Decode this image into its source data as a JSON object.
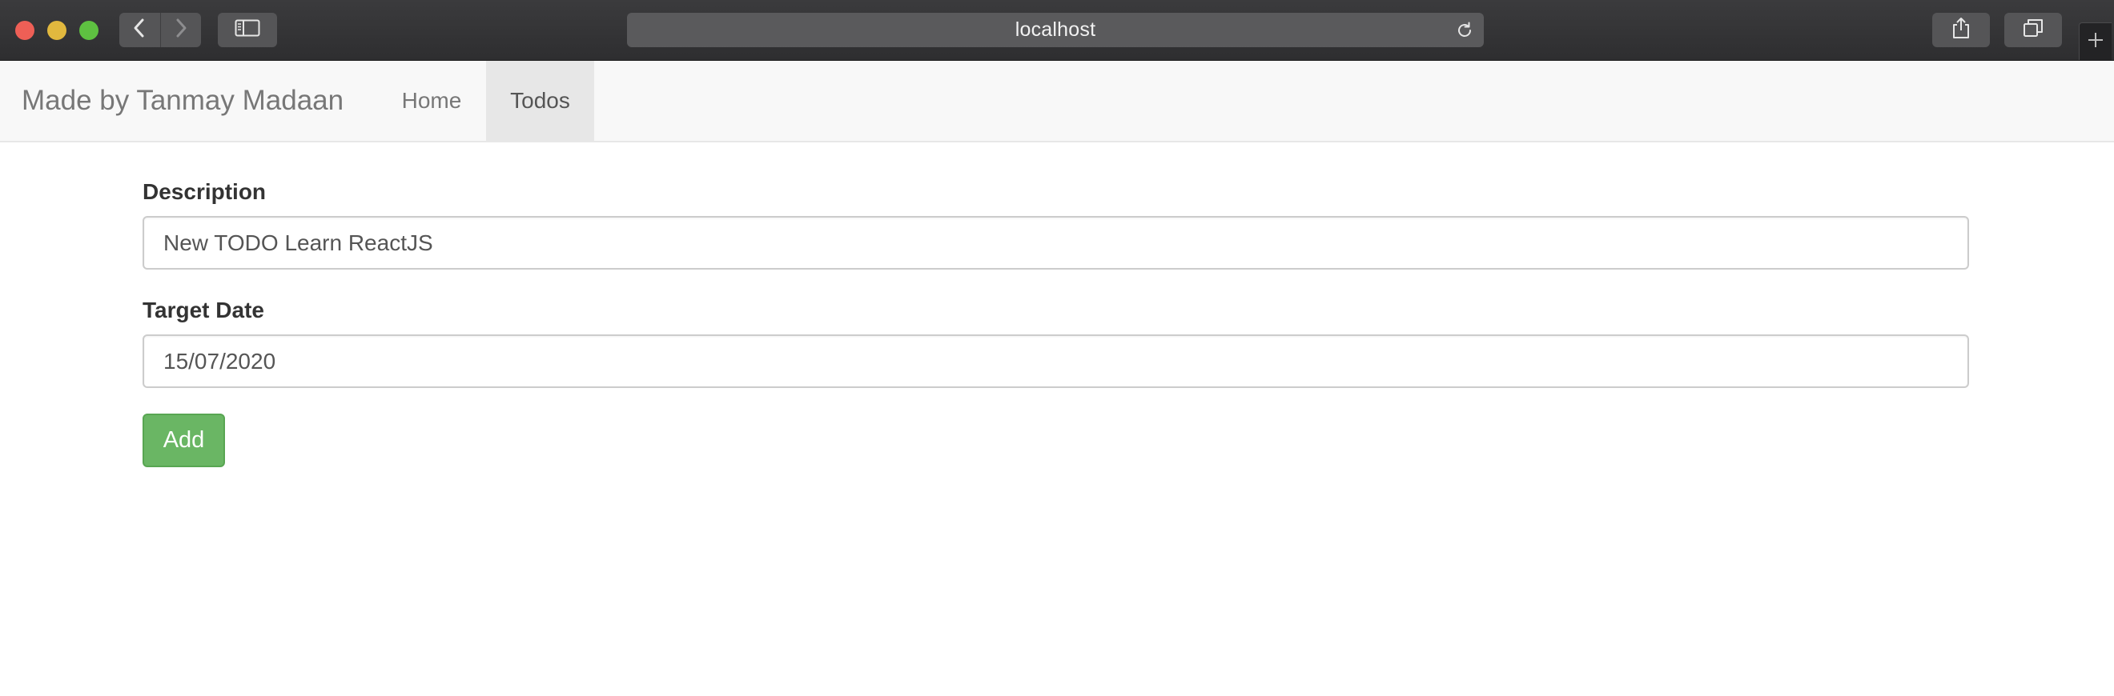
{
  "browser": {
    "url": "localhost",
    "icons": {
      "back": "chevron-left-icon",
      "forward": "chevron-right-icon",
      "sidebar": "sidebar-icon",
      "reload": "reload-icon",
      "share": "share-icon",
      "tabs": "tabs-overview-icon",
      "new_tab": "plus-icon"
    }
  },
  "navbar": {
    "brand": "Made by Tanmay Madaan",
    "links": [
      {
        "label": "Home",
        "active": false
      },
      {
        "label": "Todos",
        "active": true
      }
    ]
  },
  "form": {
    "description_label": "Description",
    "description_value": "New TODO Learn ReactJS",
    "target_date_label": "Target Date",
    "target_date_value": "15/07/2020",
    "submit_label": "Add"
  },
  "colors": {
    "chrome_bg": "#2e2e30",
    "navbar_bg": "#f8f8f8",
    "active_tab_bg": "#e7e7e7",
    "button_success": "#6ab664"
  }
}
